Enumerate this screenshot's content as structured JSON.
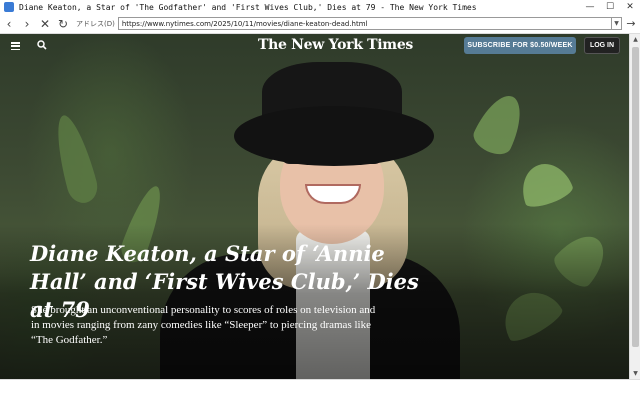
{
  "window": {
    "title": "Diane Keaton, a Star of 'The Godfather' and 'First Wives Club,' Dies at 79 - The New York Times",
    "minimize": "—",
    "maximize": "☐",
    "close": "✕"
  },
  "navbar": {
    "back": "‹",
    "forward": "›",
    "stop": "✕",
    "reload": "↻",
    "address_label": "アドレス(D)",
    "url": "https://www.nytimes.com/2025/10/11/movies/diane-keaton-dead.html",
    "go": "→"
  },
  "header": {
    "logo": "The New York Times",
    "subscribe_label": "SUBSCRIBE FOR $0.50/WEEK",
    "login_label": "LOG IN"
  },
  "article": {
    "headline": "Diane Keaton, a Star of ‘Annie Hall’ and ‘First Wives Club,’ Dies at 79",
    "summary": "She brought an unconventional personality to scores of roles on television and in movies ranging from zany comedies like “Sleeper” to piercing dramas like “The Godfather.”"
  },
  "scrollbar": {
    "up": "▲",
    "down": "▼"
  },
  "colors": {
    "subscribe_bg": "#567b95",
    "login_bg": "#222222"
  }
}
